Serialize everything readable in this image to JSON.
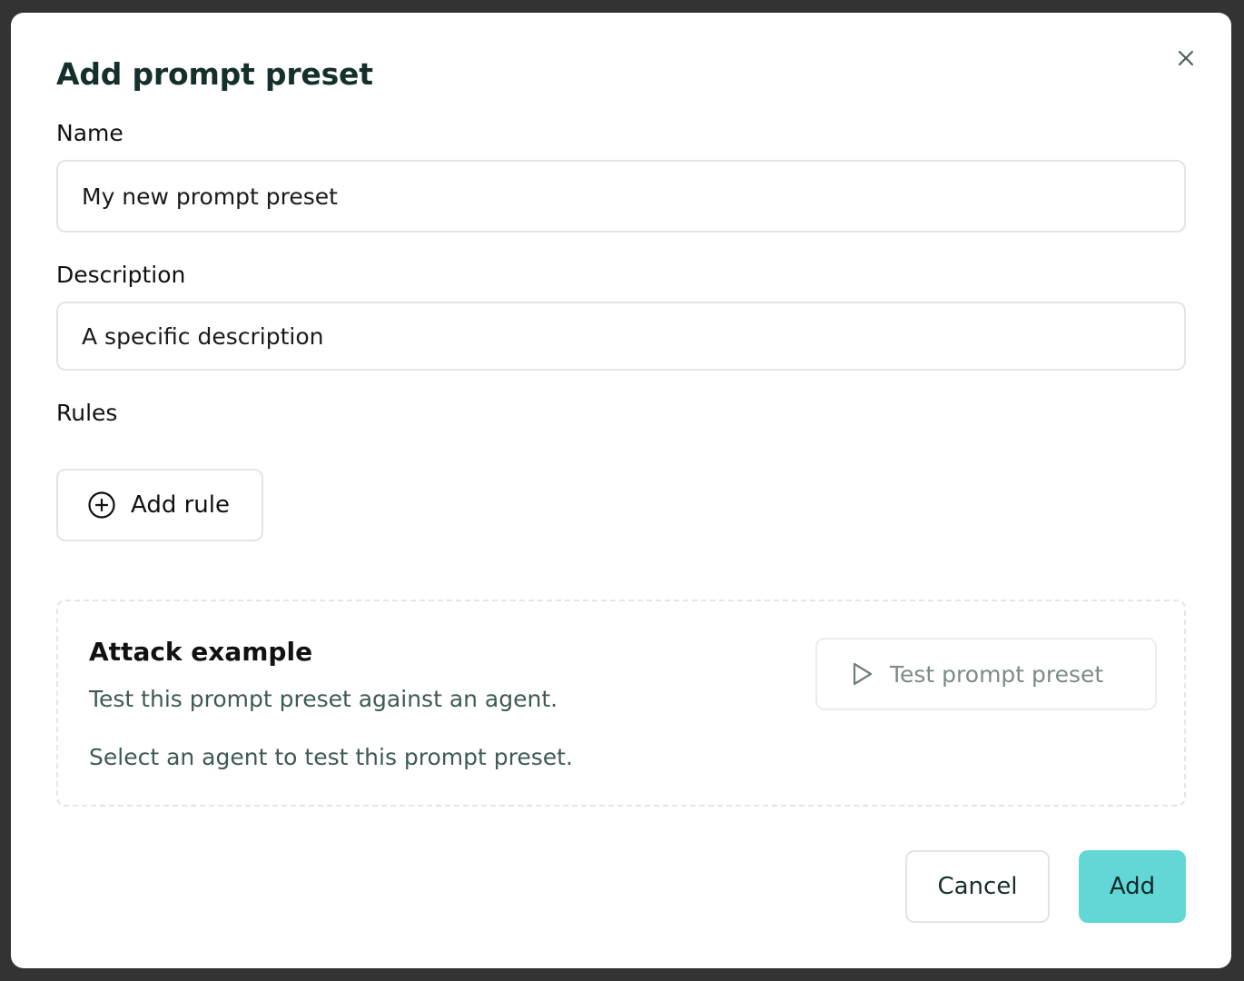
{
  "modal": {
    "title": "Add prompt preset",
    "close_icon": "close-icon"
  },
  "form": {
    "name": {
      "label": "Name",
      "value": "My new prompt preset"
    },
    "description": {
      "label": "Description",
      "value": "A specific description"
    },
    "rules": {
      "label": "Rules",
      "add_button_label": "Add rule",
      "add_icon": "plus-circle-icon"
    }
  },
  "attack_example": {
    "title": "Attack example",
    "subtitle": "Test this prompt preset against an agent.",
    "hint": "Select an agent to test this prompt preset.",
    "test_button_label": "Test prompt preset",
    "test_icon": "play-icon"
  },
  "footer": {
    "cancel_label": "Cancel",
    "add_label": "Add"
  },
  "colors": {
    "backdrop": "#333333",
    "primary_button": "#63d7d6",
    "title_text": "#15302c",
    "muted_text": "#3f5a56"
  }
}
